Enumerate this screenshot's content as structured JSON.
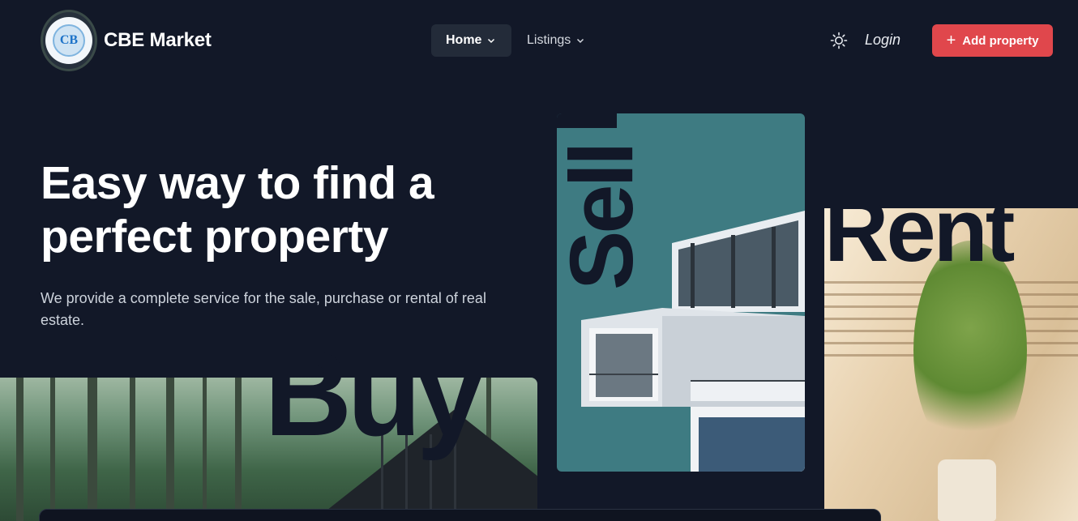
{
  "header": {
    "logo_text": "CB",
    "brand": "CBE Market",
    "nav": [
      {
        "label": "Home"
      },
      {
        "label": "Listings"
      }
    ],
    "theme_icon": "sun-icon",
    "login": "Login",
    "add_property": "Add property"
  },
  "hero": {
    "headline": "Easy way to find a perfect property",
    "subtitle": "We provide a complete service for the sale, purchase or rental of real estate.",
    "words": {
      "buy": "Buy",
      "sell": "Sell",
      "rent": "Rent"
    }
  },
  "colors": {
    "background": "#121828",
    "accent": "#e0474c",
    "teal_panel": "#3e7b82"
  }
}
